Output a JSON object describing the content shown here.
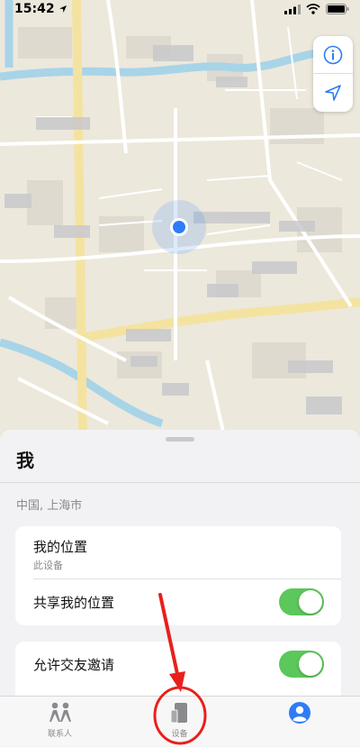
{
  "status_bar": {
    "time": "15:42"
  },
  "sheet": {
    "title": "我",
    "location": "中国, 上海市",
    "my_location": {
      "title": "我的位置",
      "subtitle": "此设备"
    },
    "share_location": {
      "label": "共享我的位置",
      "enabled": true
    },
    "allow_friend_requests": {
      "label": "允许交友邀请",
      "enabled": true
    }
  },
  "tab_bar": {
    "tabs": [
      {
        "label": "联系人",
        "icon": "people-icon"
      },
      {
        "label": "设备",
        "icon": "device-icon"
      },
      {
        "label": "",
        "icon": "person-icon",
        "selected": true
      }
    ]
  },
  "colors": {
    "toggle_on": "#5cc75a",
    "accent": "#2f7cf6",
    "annotation": "#e8201c",
    "map_land": "#ece8dc",
    "map_water": "#a8d4e8"
  },
  "icons": {
    "info": "info-icon",
    "locate": "location-arrow-icon",
    "user_dot": "current-location-dot"
  }
}
